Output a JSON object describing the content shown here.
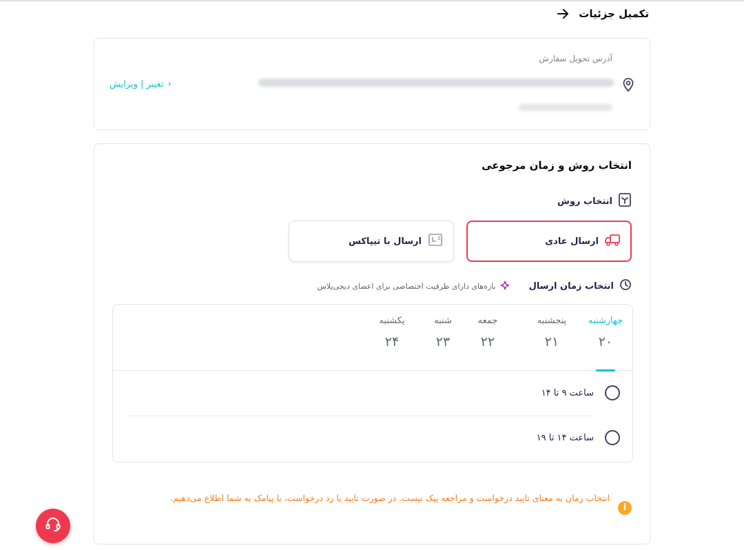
{
  "header": {
    "title": "تکمیل جزئیات"
  },
  "address": {
    "label": "آدرس تحویل سفارش",
    "edit_label": "تغییر | ویرایش"
  },
  "shipping": {
    "section_title": "انتخاب روش و زمان مرجوعی",
    "method_label": "انتخاب روش",
    "options": [
      {
        "label": "ارسال عادی",
        "selected": true
      },
      {
        "label": "ارسال با تیپاکس",
        "selected": false
      }
    ],
    "time_label": "انتخاب زمان ارسال",
    "plus_note": "بازه‌های دارای ظرفیت اختصاصی برای اعضای دیجی‌پلاس",
    "days": [
      {
        "name": "چهارشنبه",
        "num": "۲۰",
        "active": true
      },
      {
        "name": "پنجشنبه",
        "num": "۲۱",
        "active": false
      },
      {
        "name": "جمعه",
        "num": "۲۲",
        "active": false
      },
      {
        "name": "شنبه",
        "num": "۲۳",
        "active": false
      },
      {
        "name": "یکشنبه",
        "num": "۲۴",
        "active": false
      }
    ],
    "slots": [
      {
        "label": "ساعت  ۹ تا ۱۴"
      },
      {
        "label": "ساعت  ۱۴ تا ۱۹"
      }
    ],
    "notice": "انتخاب زمان به معنای تایید درخواست و مراجعه پیک نیست. در صورت تایید یا رد درخواست، با پیامک به شما اطلاع می‌دهیم."
  },
  "colors": {
    "accent": "#19bfd3",
    "brand": "#ef394e",
    "warning": "#f57c1c",
    "text": "#23254e"
  },
  "icons": {
    "back": "arrow-right-icon",
    "pin": "location-pin-icon",
    "method": "shipping-method-icon",
    "normal": "truck-icon",
    "tipax": "tipax-box-icon",
    "clock": "clock-icon",
    "plus": "digiplus-sparkle-icon",
    "info": "info-icon",
    "support": "headset-icon"
  }
}
